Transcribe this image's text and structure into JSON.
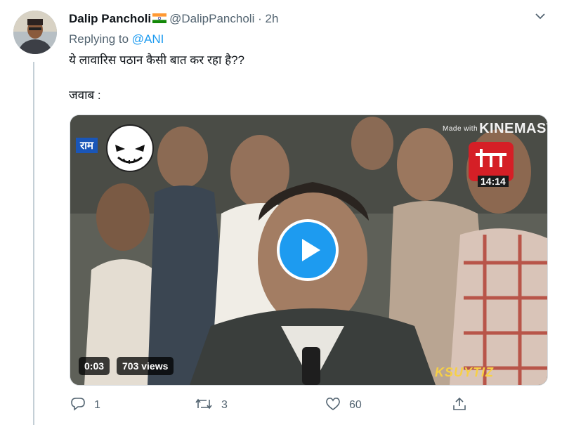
{
  "tweet": {
    "display_name": "Dalip Pancholi",
    "handle": "@DalipPancholi",
    "separator": "·",
    "time": "2h",
    "replying_prefix": "Replying to",
    "replying_to": "@ANI",
    "text_line1": "ये लावारिस पठान कैसी बात कर रहा है??",
    "text_line2": "जवाब :"
  },
  "video": {
    "duration": "0:03",
    "views": "703 views",
    "watermark_made_with": "Made with",
    "watermark_app": "KINEMASTER",
    "channel_badge_time": "14:14",
    "ticker_text": "राम",
    "bottom_watermark": "KSUYTIZ"
  },
  "actions": {
    "replies": "1",
    "retweets": "3",
    "likes": "60"
  },
  "colors": {
    "accent": "#1d9bf0",
    "muted": "#536471"
  },
  "icons": [
    "reply-icon",
    "retweet-icon",
    "like-icon",
    "share-icon",
    "chevron-down-icon",
    "play-icon",
    "india-flag-icon"
  ]
}
